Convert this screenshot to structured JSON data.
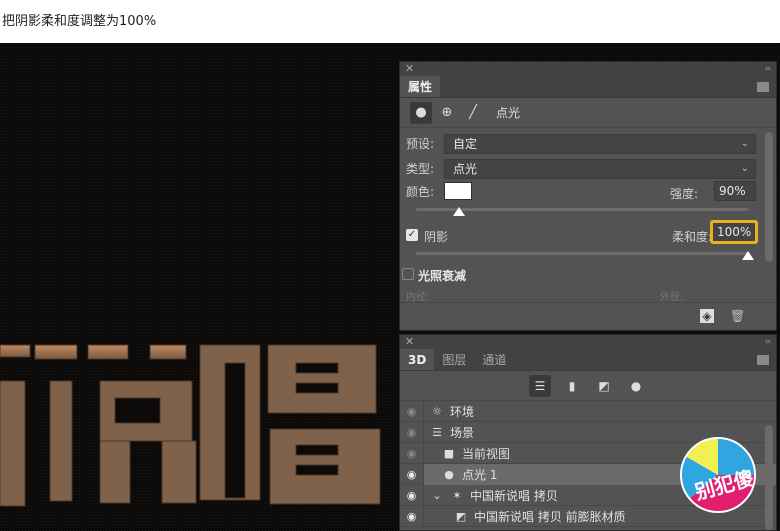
{
  "caption": "把阴影柔和度调整为100%",
  "canvas_text": "新说唱",
  "properties_panel": {
    "close_glyph": "✕",
    "collapse_glyph": "‹‹",
    "tab_label": "属性",
    "mode_label": "点光",
    "preset": {
      "label": "预设:",
      "value": "自定"
    },
    "type": {
      "label": "类型:",
      "value": "点光"
    },
    "color": {
      "label": "颜色:",
      "value": "#ffffff"
    },
    "intensity": {
      "label": "强度:",
      "value": "90%",
      "slider_fraction": 0.13
    },
    "shadow": {
      "label": "阴影",
      "checked": true
    },
    "softness": {
      "label": "柔和度:",
      "value": "100%",
      "slider_fraction": 1.0,
      "highlight_color": "#e8b21c"
    },
    "falloff": {
      "label": "光照衰减",
      "checked": false
    },
    "inner_label": "内径:",
    "outer_label": "外径:"
  },
  "layers_panel": {
    "tabs": [
      {
        "label": "3D",
        "active": true
      },
      {
        "label": "图层",
        "active": false
      },
      {
        "label": "通道",
        "active": false
      }
    ],
    "items": [
      {
        "label": "环境",
        "icon": "environment-icon",
        "glyph": "☼",
        "eye_bright": false,
        "indent": 0
      },
      {
        "label": "场景",
        "icon": "scene-icon",
        "glyph": "☰",
        "eye_bright": false,
        "indent": 0
      },
      {
        "label": "当前视图",
        "icon": "camera-icon",
        "glyph": "■",
        "eye_bright": false,
        "indent": 1
      },
      {
        "label": "点光 1",
        "icon": "bulb-icon",
        "glyph": "●",
        "eye_bright": true,
        "indent": 1,
        "selected": true
      },
      {
        "label": "中国新说唱 拷贝",
        "icon": "mesh-icon",
        "glyph": "✶",
        "eye_bright": true,
        "indent": 0,
        "expanded": true
      },
      {
        "label": "中国新说唱 拷贝 前膨胀材质",
        "icon": "material-icon",
        "glyph": "◩",
        "eye_bright": true,
        "indent": 2
      }
    ]
  },
  "badge_text": "别犯傻"
}
